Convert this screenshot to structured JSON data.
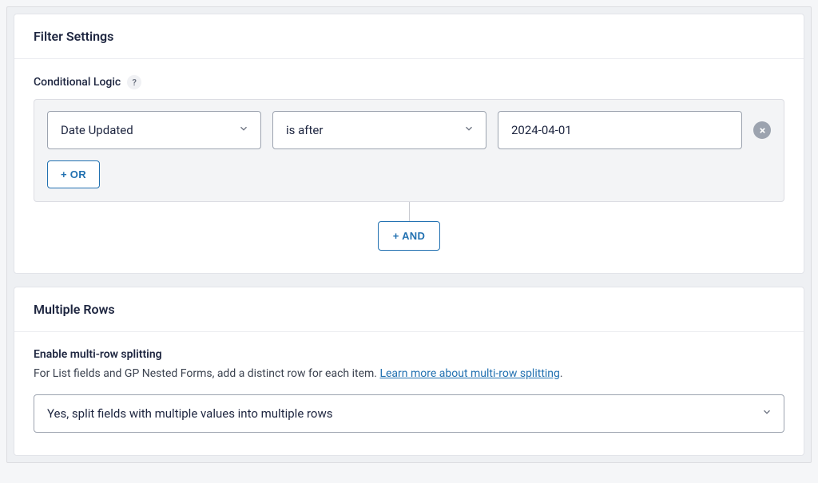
{
  "filter_settings": {
    "title": "Filter Settings",
    "conditional_logic_label": "Conditional Logic",
    "rule": {
      "field": "Date Updated",
      "operator": "is after",
      "value": "2024-04-01"
    },
    "or_button": "+ OR",
    "and_button": "+ AND"
  },
  "multiple_rows": {
    "title": "Multiple Rows",
    "enable_label": "Enable multi-row splitting",
    "description_prefix": "For List fields and GP Nested Forms, add a distinct row for each item. ",
    "learn_more_text": "Learn more about multi-row splitting",
    "description_suffix": ".",
    "select_value": "Yes, split fields with multiple values into multiple rows"
  }
}
